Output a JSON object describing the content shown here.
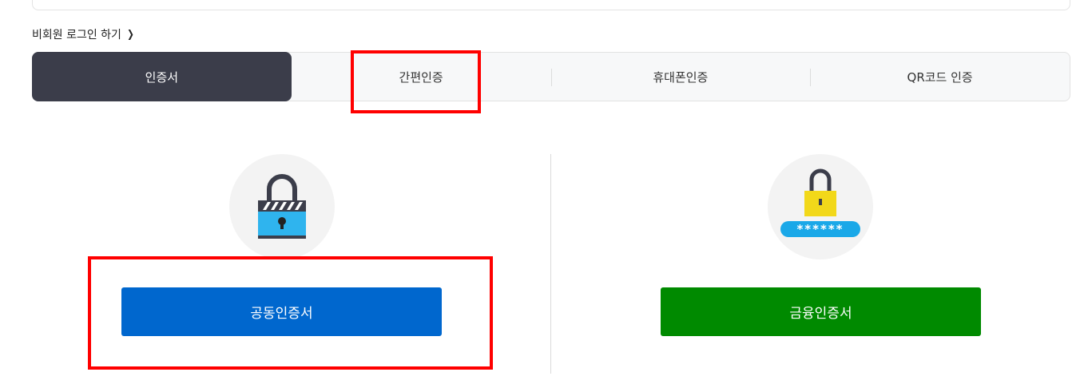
{
  "guest_login": {
    "label": "비회원 로그인 하기",
    "chevron": "›"
  },
  "tabs": [
    {
      "label": "인증서",
      "active": true
    },
    {
      "label": "간편인증",
      "active": false
    },
    {
      "label": "휴대폰인증",
      "active": false
    },
    {
      "label": "QR코드 인증",
      "active": false
    }
  ],
  "certificates": {
    "joint": {
      "label": "공동인증서",
      "icon": "padlock-icon",
      "color": "#0067ce"
    },
    "financial": {
      "label": "금융인증서",
      "icon": "padlock-password-icon",
      "password_mask": "******",
      "color": "#008a00"
    }
  },
  "colors": {
    "active_tab": "#3b3d4a",
    "highlight": "#ff0000"
  }
}
